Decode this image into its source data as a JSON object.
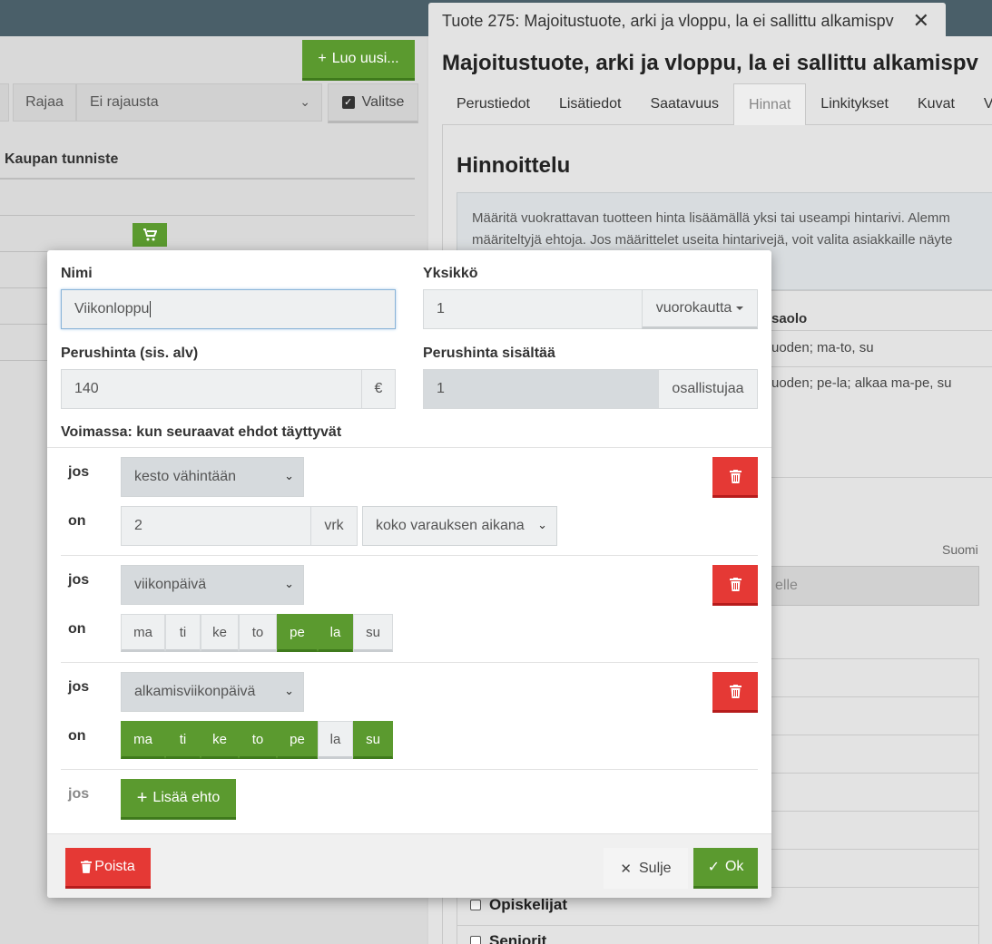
{
  "left_panel": {
    "create_label": "Luo uusi...",
    "filter_label": "Rajaa",
    "filter_value": "Ei rajausta",
    "select_label": "Valitse",
    "column_header": "Kaupan tunniste"
  },
  "right_panel": {
    "tab_title": "Tuote 275: Majoitustuote, arki ja vloppu, la ei sallittu alkamispv",
    "title": "Majoitustuote, arki ja vloppu, la ei sallittu alkamispv",
    "tabs": [
      "Perustiedot",
      "Lisätiedot",
      "Saatavuus",
      "Hinnat",
      "Linkitykset",
      "Kuvat",
      "V"
    ],
    "active_tab": "Hinnat",
    "section_title": "Hinnoittelu",
    "info_line1": "Määritä vuokrattavan tuotteen hinta lisäämällä yksi tai useampi hintarivi. Alemm",
    "info_line2": "määriteltyjä ehtoja. Jos määrittelet useita hintarivejä, voit valita asiakkaille näyte",
    "col_header_fragment": "saolo",
    "row1_fragment": "uoden; ma-to, su",
    "row2_fragment": "uoden; pe-la; alkaa ma-pe, su",
    "language": "Suomi",
    "input_placeholder_fragment": "elle",
    "check1": "Opiskelijat",
    "check2": "Seniorit"
  },
  "modal": {
    "name_label": "Nimi",
    "name_value": "Viikonloppu",
    "unit_label": "Yksikkö",
    "unit_value": "1",
    "unit_select": "vuorokautta",
    "price_label": "Perushinta (sis. alv)",
    "price_value": "140",
    "currency": "€",
    "includes_label": "Perushinta sisältää",
    "includes_value": "1",
    "includes_unit": "osallistujaa",
    "valid_label": "Voimassa: kun seuraavat ehdot täyttyvät",
    "if_label": "jos",
    "is_label": "on",
    "conditions": [
      {
        "type": "kesto vähintään",
        "value": "2",
        "value_unit": "vrk",
        "scope": "koko varauksen aikana"
      },
      {
        "type": "viikonpäivä",
        "days": [
          {
            "label": "ma",
            "active": false
          },
          {
            "label": "ti",
            "active": false
          },
          {
            "label": "ke",
            "active": false
          },
          {
            "label": "to",
            "active": false
          },
          {
            "label": "pe",
            "active": true
          },
          {
            "label": "la",
            "active": true
          },
          {
            "label": "su",
            "active": false
          }
        ]
      },
      {
        "type": "alkamisviikonpäivä",
        "days": [
          {
            "label": "ma",
            "active": true
          },
          {
            "label": "ti",
            "active": true
          },
          {
            "label": "ke",
            "active": true
          },
          {
            "label": "to",
            "active": true
          },
          {
            "label": "pe",
            "active": true
          },
          {
            "label": "la",
            "active": false
          },
          {
            "label": "su",
            "active": true
          }
        ]
      }
    ],
    "add_condition": "Lisää ehto",
    "delete_label": "Poista",
    "close_label": "Sulje",
    "ok_label": "Ok"
  },
  "colors": {
    "green": "#5b9a2f",
    "red": "#e53935",
    "topbar": "#4a5f69"
  }
}
